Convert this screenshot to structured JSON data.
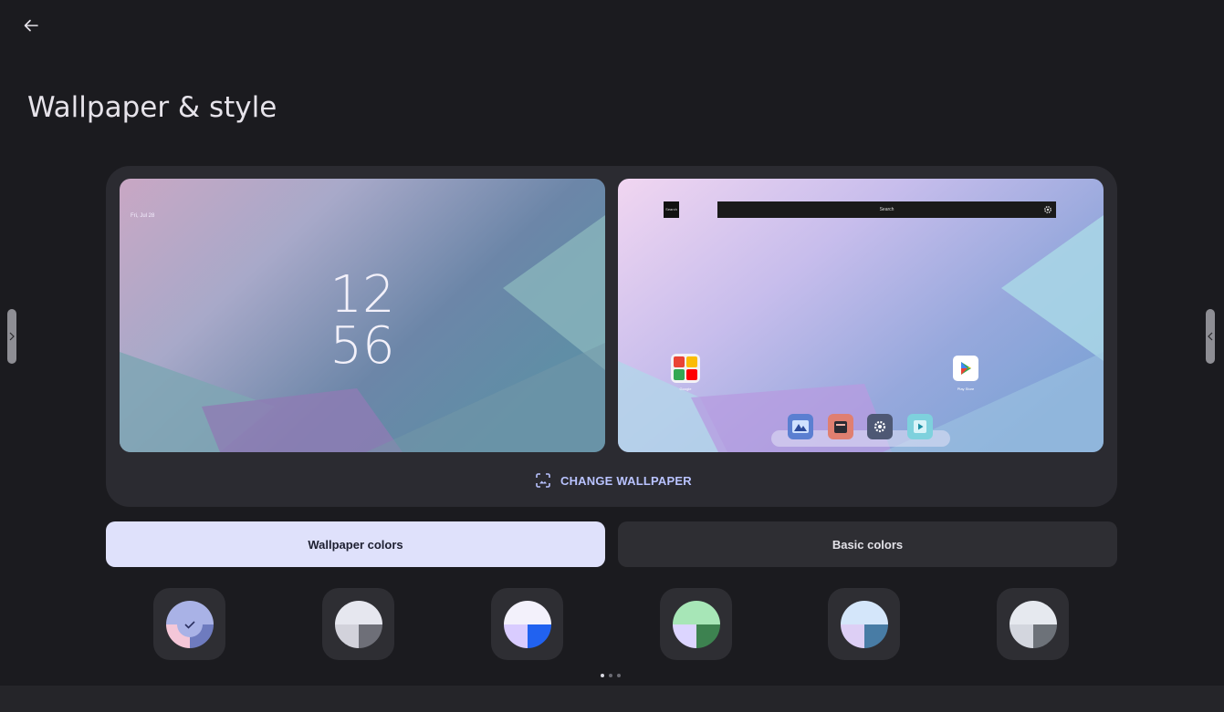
{
  "title": "Wallpaper & style",
  "preview": {
    "lock": {
      "date": "Fri, Jul 28",
      "clock_hour": "12",
      "clock_minute": "56"
    },
    "home": {
      "search_button": "Search",
      "search_bar": "Search",
      "folder_label": "Google",
      "play_label": "Play Store"
    }
  },
  "change_wallpaper_label": "CHANGE WALLPAPER",
  "tabs": [
    {
      "label": "Wallpaper colors",
      "selected": true
    },
    {
      "label": "Basic colors",
      "selected": false
    }
  ],
  "swatches": [
    {
      "top": "#a9b2e6",
      "bottom_left": "#f4c7d8",
      "bottom_right": "#6e7bbf",
      "selected": true
    },
    {
      "top": "#e6e7ef",
      "bottom_left": "#d2d2db",
      "bottom_right": "#6e6f78",
      "selected": false
    },
    {
      "top": "#f3f1fb",
      "bottom_left": "#d9ccff",
      "bottom_right": "#2162f0",
      "selected": false
    },
    {
      "top": "#a7e6b7",
      "bottom_left": "#dcd5ff",
      "bottom_right": "#3d8250",
      "selected": false
    },
    {
      "top": "#d4e6fa",
      "bottom_left": "#ddcff5",
      "bottom_right": "#487ca5",
      "selected": false
    },
    {
      "top": "#e6e9ef",
      "bottom_left": "#d3d6de",
      "bottom_right": "#6d7279",
      "selected": false
    }
  ],
  "page_indicator": {
    "count": 3,
    "current": 1
  },
  "colors": {
    "accent": "#b9c3ff",
    "background": "#1b1b1f",
    "card": "#2b2b31"
  }
}
